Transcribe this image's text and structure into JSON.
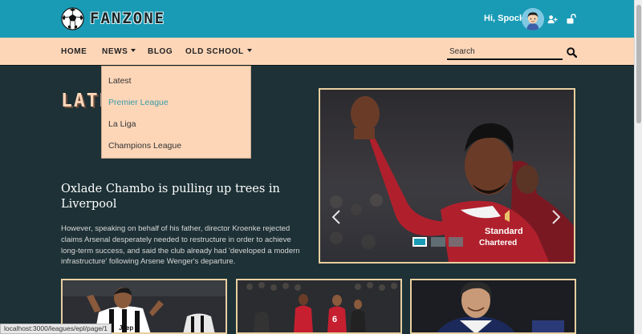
{
  "header": {
    "brand": "FANZONE",
    "greeting": "Hi, Spock!",
    "icons": [
      "soccer-ball-icon",
      "user-plus-icon",
      "unlock-icon"
    ],
    "colors": {
      "topbar": "#1a9bb5",
      "navbar": "#fdd6b8",
      "page": "#1d3136"
    }
  },
  "nav": {
    "items": [
      {
        "label": "HOME"
      },
      {
        "label": "NEWS",
        "has_dropdown": true
      },
      {
        "label": "BLOG"
      },
      {
        "label": "OLD SCHOOL",
        "has_dropdown": true
      }
    ],
    "search_placeholder": "Search"
  },
  "news_dropdown": {
    "items": [
      {
        "label": "Latest"
      },
      {
        "label": "Premier League",
        "active": true
      },
      {
        "label": "La Liga"
      },
      {
        "label": "Champions League"
      }
    ]
  },
  "main": {
    "section_heading": "LATEST",
    "article": {
      "title": "Oxlade Chambo is pulling up trees in Liverpool",
      "body": "However, speaking on behalf of his father, director Kroenke rejected claims Arsenal desperately needed to restructure in order to achieve long-term success, and said the club already had 'developed a modern infrastructure' following Arsene Wenger's departure."
    },
    "carousel": {
      "slide_count": 3,
      "active_index": 0,
      "shirt_text": "Standard Chartered"
    }
  },
  "status_bar": {
    "url": "localhost:3000/leagues/epl/page/1"
  }
}
